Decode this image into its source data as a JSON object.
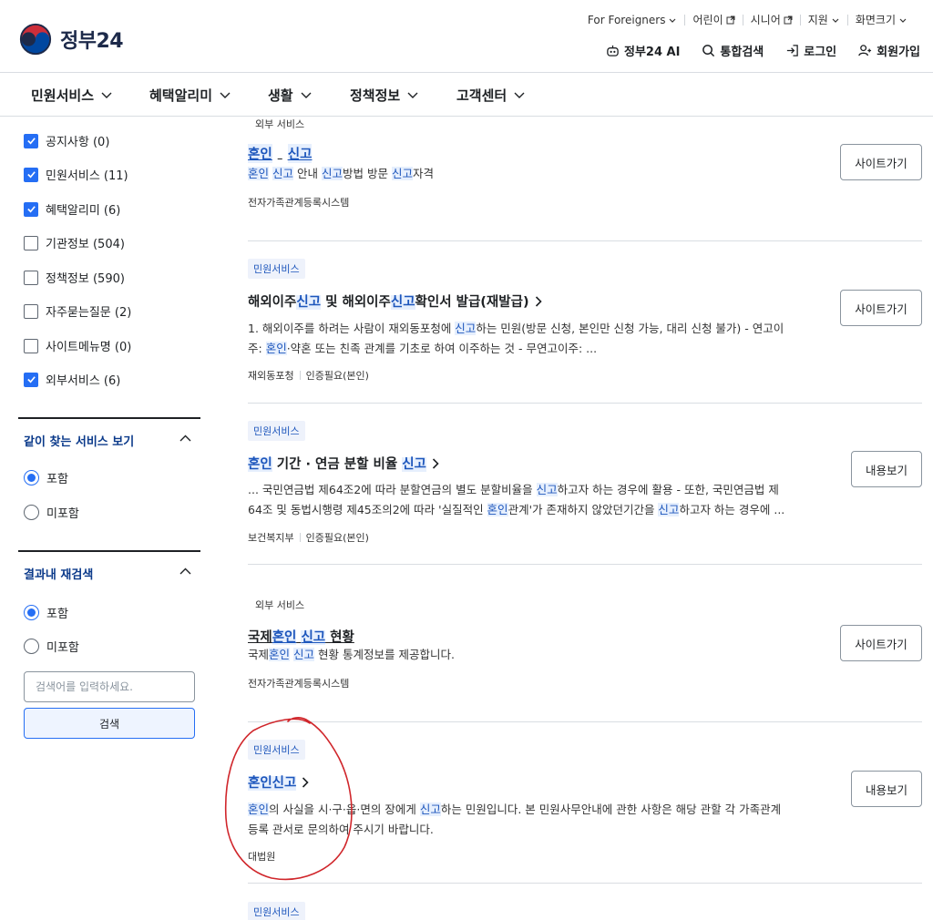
{
  "header": {
    "logo_text": "정부24",
    "util": [
      "For Foreigners",
      "어린이",
      "시니어",
      "지원",
      "화면크기"
    ],
    "topnav": [
      "정부24 AI",
      "통합검색",
      "로그인",
      "회원가입"
    ]
  },
  "gnb": [
    "민원서비스",
    "혜택알리미",
    "생활",
    "정책정보",
    "고객센터"
  ],
  "sidebar": {
    "filters": [
      {
        "label": "공지사항 (0)",
        "checked": true
      },
      {
        "label": "민원서비스 (11)",
        "checked": true
      },
      {
        "label": "혜택알리미 (6)",
        "checked": true
      },
      {
        "label": "기관정보 (504)",
        "checked": false
      },
      {
        "label": "정책정보 (590)",
        "checked": false
      },
      {
        "label": "자주묻는질문 (2)",
        "checked": false
      },
      {
        "label": "사이트메뉴명 (0)",
        "checked": false
      },
      {
        "label": "외부서비스 (6)",
        "checked": true
      }
    ],
    "section1": {
      "title": "같이 찾는 서비스 보기",
      "options": [
        "포함",
        "미포함"
      ]
    },
    "section2": {
      "title": "결과내 재검색",
      "options": [
        "포함",
        "미포함"
      ],
      "placeholder": "검색어를 입력하세요.",
      "button": "검색"
    }
  },
  "results": [
    {
      "category": "외부 서비스",
      "title": "혼인 신고",
      "desc1": "혼인 신고 안내 신고방법 방문 신고자격",
      "desc2": "",
      "meta": [
        "전자가족관계등록시스템"
      ],
      "action": "사이트가기"
    },
    {
      "category": "민원서비스",
      "title": "해외이주신고 및 해외이주신고확인서 발급(재발급)",
      "desc1": "1. 해외이주를 하려는 사람이 재외동포청에 신고하는 민원(방문 신청, 본인만 신청 가능, 대리 신청 불가) - 연고이",
      "desc2": "주: 혼인·약혼 또는 친족 관계를 기초로 하여 이주하는 것 - 무연고이주: ...",
      "meta": [
        "재외동포청",
        "인증필요(본인)"
      ],
      "action": "사이트가기"
    },
    {
      "category": "민원서비스",
      "title": "혼인 기간 · 연금 분할 비율 신고",
      "desc1": "... 국민연금법 제64조2에 따라 분할연금의 별도 분할비율을 신고하고자 하는 경우에 활용 - 또한, 국민연금법 제",
      "desc2": "64조 및 동법시행령 제45조의2에 따라 '실질적인 혼인관계'가 존재하지 않았던기간을 신고하고자 하는 경우에 ...",
      "meta": [
        "보건복지부",
        "인증필요(본인)"
      ],
      "action": "내용보기"
    },
    {
      "category": "외부 서비스",
      "title": "국제혼인 신고 현황",
      "desc1": "국제혼인 신고 현황 통계정보를 제공합니다.",
      "desc2": "",
      "meta": [
        "전자가족관계등록시스템"
      ],
      "action": "사이트가기"
    },
    {
      "category": "민원서비스",
      "title": "혼인신고",
      "desc1": "혼인의 사실을 시·구·읍·면의 장에게 신고하는 민원입니다. 본 민원사무안내에 관한 사항은 해당 관할 각 가족관계",
      "desc2": "등록 관서로 문의하여 주시기 바랍니다.",
      "meta": [
        "대법원"
      ],
      "action": "내용보기"
    },
    {
      "category": "민원서비스"
    }
  ],
  "colors": {
    "accent": "#256ef4",
    "highlight_text": "#1d56bc",
    "annotation": "#d0262b"
  }
}
